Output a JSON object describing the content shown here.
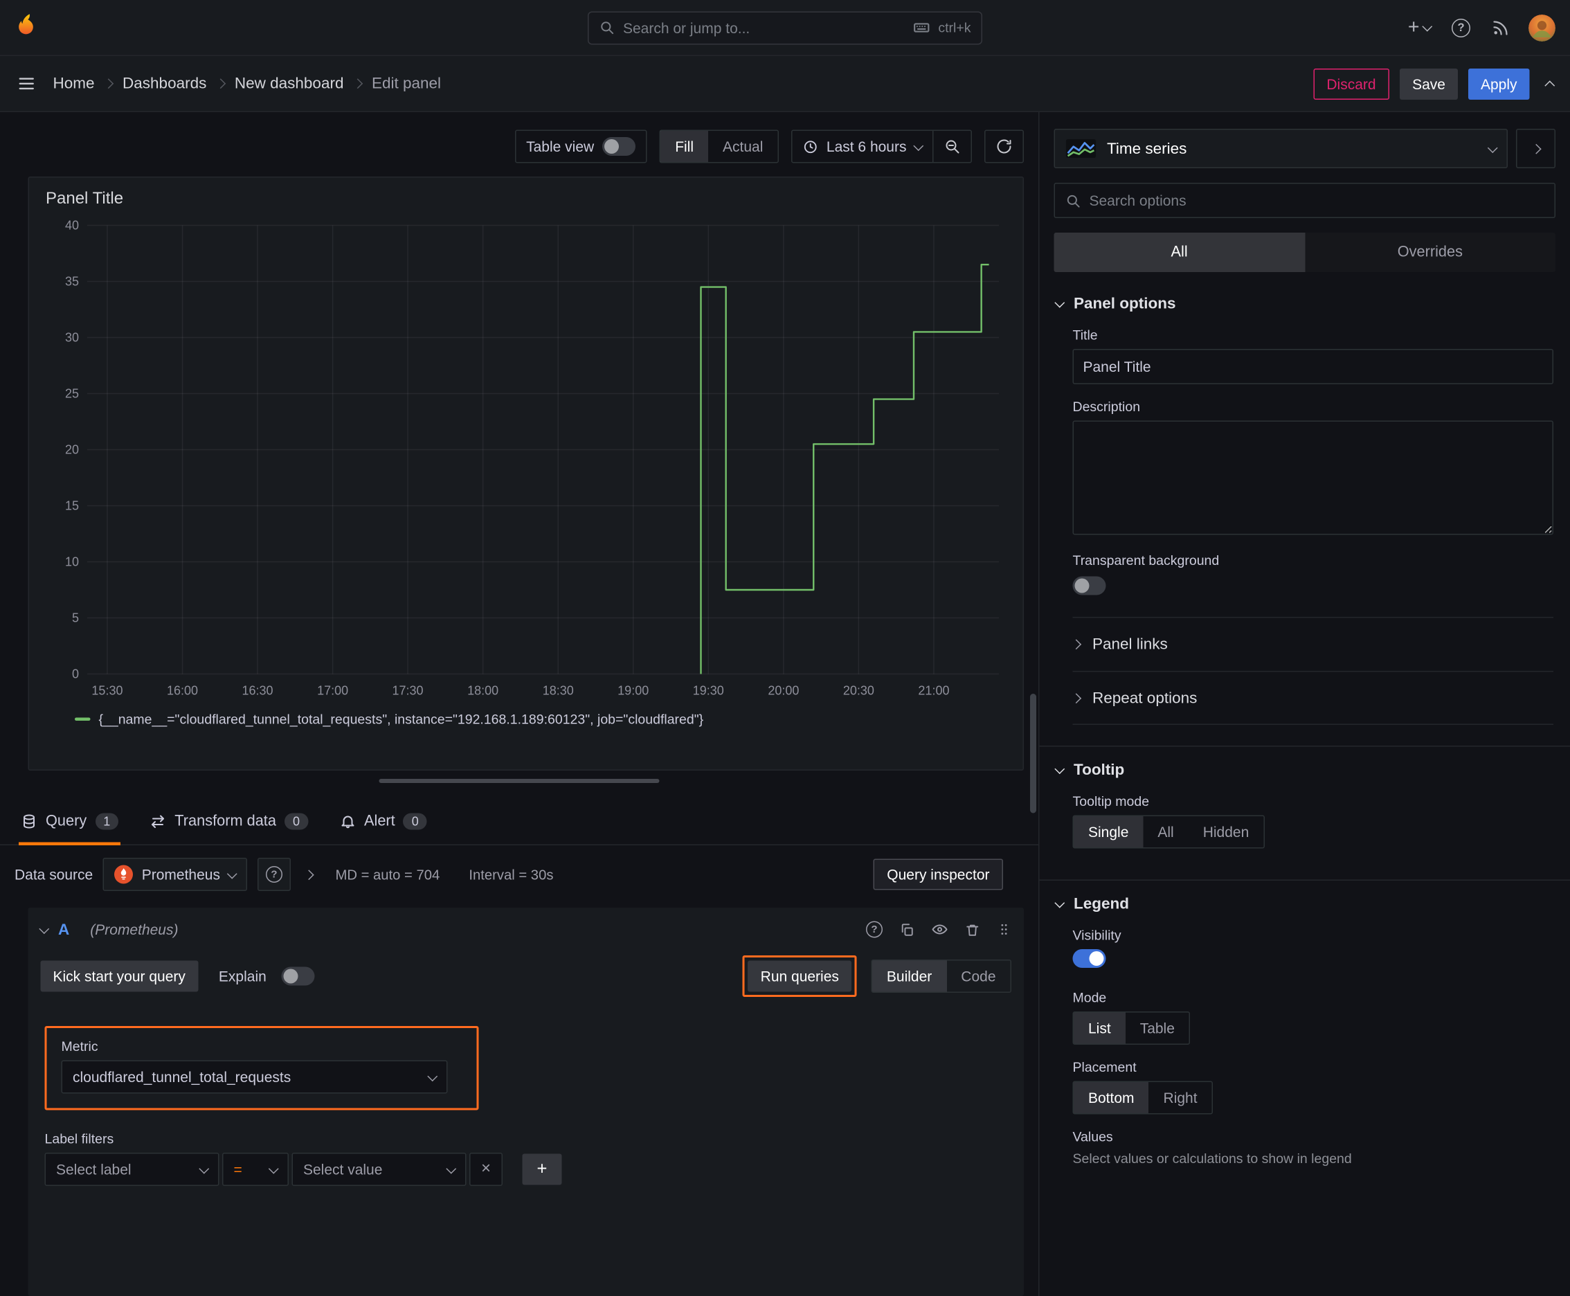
{
  "colors": {
    "accent_orange": "#ff780a",
    "primary_blue": "#3d71d9",
    "destructive_pink": "#e0226e",
    "series_green": "#73bf69",
    "highlight_outline": "#ff6b1f"
  },
  "icons": {
    "help": "?",
    "plus": "+",
    "close": "×"
  },
  "topbar": {
    "search_placeholder": "Search or jump to...",
    "shortcut": "ctrl+k"
  },
  "breadcrumb": {
    "items": [
      "Home",
      "Dashboards",
      "New dashboard",
      "Edit panel"
    ]
  },
  "header_actions": {
    "discard": "Discard",
    "save": "Save",
    "apply": "Apply"
  },
  "panel_toolbar": {
    "table_view": "Table view",
    "fill": "Fill",
    "actual": "Actual",
    "time_range": "Last 6 hours"
  },
  "panel": {
    "title": "Panel Title"
  },
  "chart_data": {
    "type": "line",
    "step": true,
    "title": "Panel Title",
    "x_tick_labels": [
      "15:30",
      "16:00",
      "16:30",
      "17:00",
      "17:30",
      "18:00",
      "18:30",
      "19:00",
      "19:30",
      "20:00",
      "20:30",
      "21:00"
    ],
    "x_tick_minutes": [
      0,
      30,
      60,
      90,
      120,
      150,
      180,
      210,
      240,
      270,
      300,
      330
    ],
    "x_domain_minutes": [
      -8,
      356
    ],
    "y_ticks": [
      0,
      5,
      10,
      15,
      20,
      25,
      30,
      35,
      40
    ],
    "ylim": [
      0,
      40
    ],
    "grid": true,
    "legend_position": "bottom",
    "series": [
      {
        "name": "{__name__=\"cloudflared_tunnel_total_requests\", instance=\"192.168.1.189:60123\", job=\"cloudflared\"}",
        "color": "#73bf69",
        "points": [
          [
            237,
            0
          ],
          [
            237,
            34.5
          ],
          [
            247,
            34.5
          ],
          [
            247,
            7.5
          ],
          [
            282,
            7.5
          ],
          [
            282,
            20.5
          ],
          [
            306,
            20.5
          ],
          [
            306,
            24.5
          ],
          [
            322,
            24.5
          ],
          [
            322,
            30.5
          ],
          [
            349,
            30.5
          ],
          [
            349,
            36.5
          ],
          [
            352,
            36.5
          ]
        ]
      }
    ]
  },
  "editor_tabs": {
    "query": "Query",
    "query_count": "1",
    "transform": "Transform data",
    "transform_count": "0",
    "alert": "Alert",
    "alert_count": "0"
  },
  "datasource_bar": {
    "label": "Data source",
    "name": "Prometheus",
    "max_data_points": "MD = auto = 704",
    "interval": "Interval = 30s",
    "inspector": "Query inspector"
  },
  "query_editor": {
    "ref_id": "A",
    "ds_hint": "(Prometheus)",
    "kickstart": "Kick start your query",
    "explain": "Explain",
    "run_queries": "Run queries",
    "builder": "Builder",
    "code": "Code",
    "metric_label": "Metric",
    "metric_value": "cloudflared_tunnel_total_requests",
    "label_filters_label": "Label filters",
    "select_label_placeholder": "Select label",
    "operator": "=",
    "select_value_placeholder": "Select value"
  },
  "sidebar": {
    "visualization": "Time series",
    "search_placeholder": "Search options",
    "tab_all": "All",
    "tab_overrides": "Overrides",
    "panel_options": {
      "title": "Panel options",
      "title_label": "Title",
      "title_value": "Panel Title",
      "description_label": "Description",
      "transparent_label": "Transparent background",
      "panel_links": "Panel links",
      "repeat_options": "Repeat options"
    },
    "tooltip": {
      "title": "Tooltip",
      "mode_label": "Tooltip mode",
      "options": [
        "Single",
        "All",
        "Hidden"
      ]
    },
    "legend": {
      "title": "Legend",
      "visibility_label": "Visibility",
      "mode_label": "Mode",
      "mode_options": [
        "List",
        "Table"
      ],
      "placement_label": "Placement",
      "placement_options": [
        "Bottom",
        "Right"
      ],
      "values_label": "Values",
      "values_help": "Select values or calculations to show in legend"
    }
  }
}
